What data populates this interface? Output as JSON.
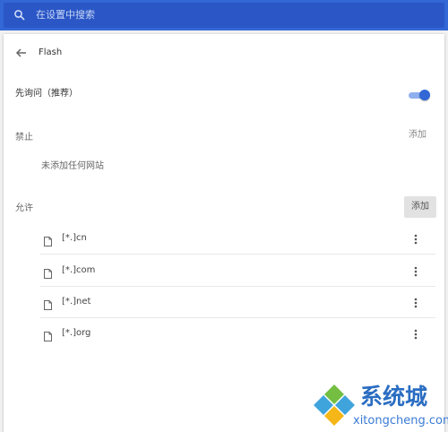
{
  "search": {
    "placeholder": "在设置中搜索"
  },
  "header": {
    "title": "Flash"
  },
  "ask_setting": {
    "label": "先询问（推荐）",
    "enabled": true
  },
  "block_section": {
    "label": "禁止",
    "add_label": "添加",
    "empty_text": "未添加任何网站"
  },
  "allow_section": {
    "label": "允许",
    "add_label": "添加",
    "sites": [
      {
        "pattern": "[*.]cn"
      },
      {
        "pattern": "[*.]com"
      },
      {
        "pattern": "[*.]net"
      },
      {
        "pattern": "[*.]org"
      }
    ]
  },
  "watermark": {
    "brand": "系统城",
    "url": "xitongcheng.com"
  },
  "colors": {
    "header_bg": "#3367d6",
    "toggle_on": "#3367d6",
    "card_bg": "#ffffff"
  },
  "icons": [
    "search-icon",
    "back-arrow-icon",
    "toggle-switch",
    "file-icon",
    "more-vert-icon"
  ]
}
